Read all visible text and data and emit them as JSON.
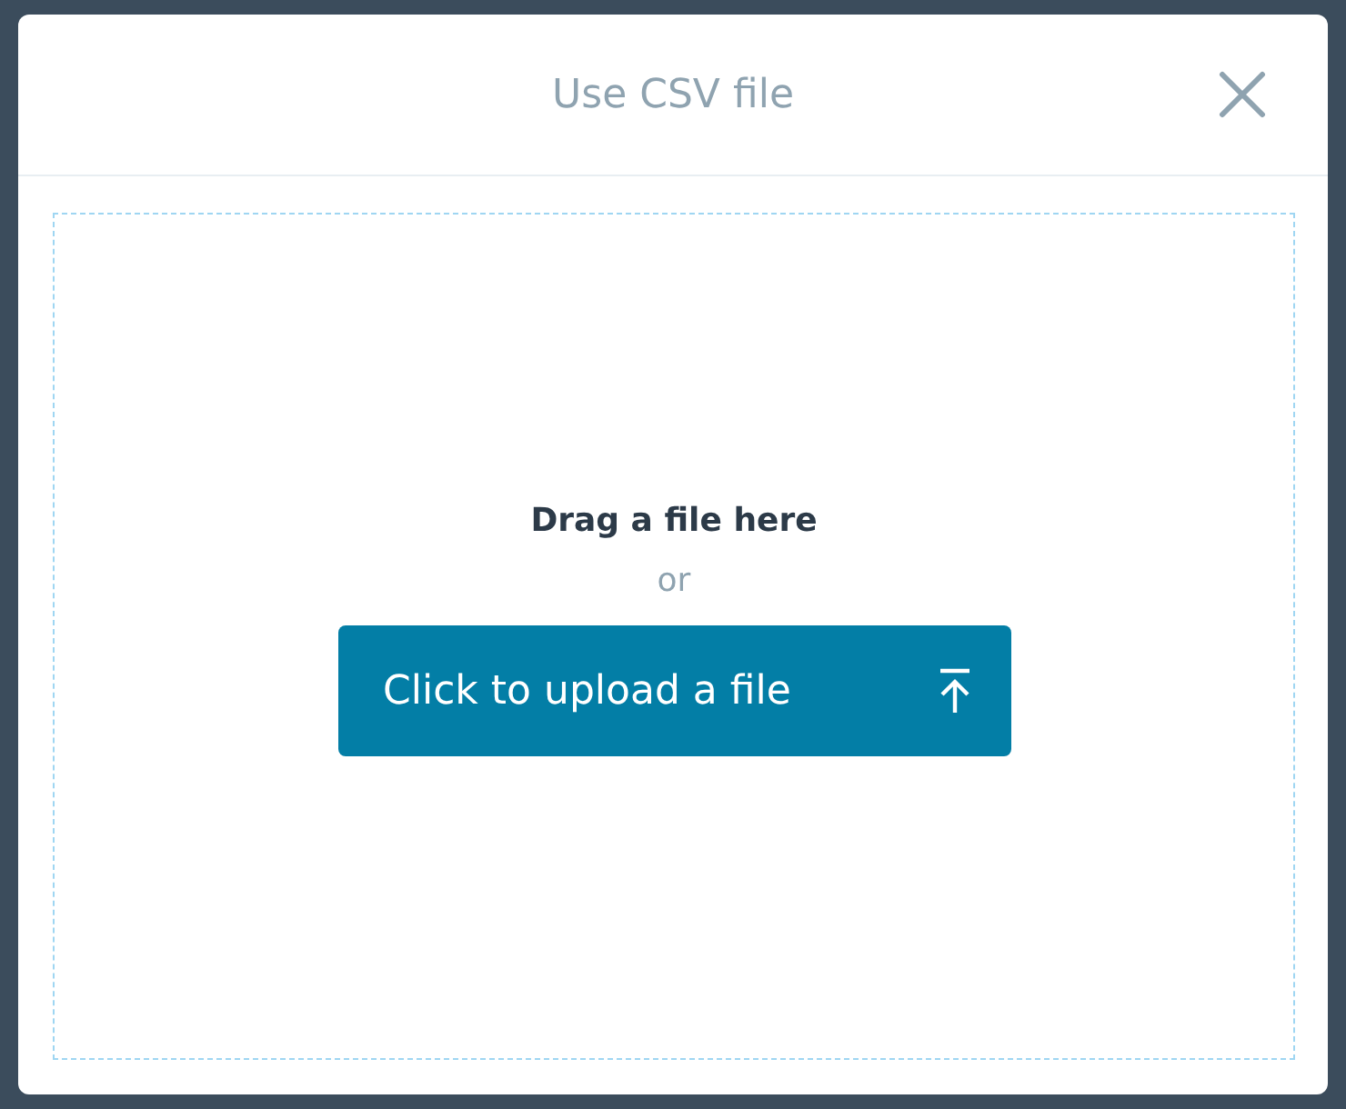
{
  "dialog": {
    "title": "Use CSV file"
  },
  "dropzone": {
    "prompt": "Drag a file here",
    "separator": "or",
    "upload_button": "Click to upload a file"
  }
}
